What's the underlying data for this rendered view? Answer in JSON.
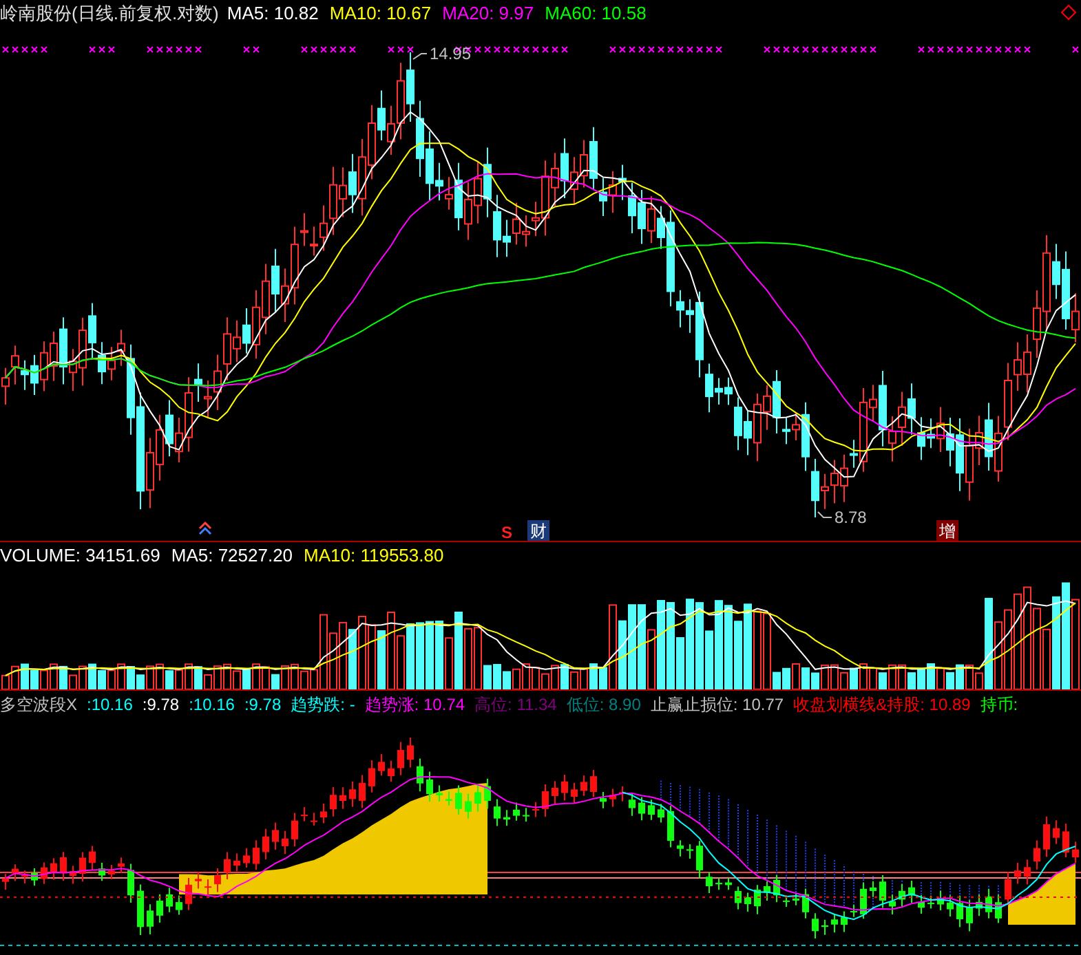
{
  "chart": {
    "title": "岭南股份(日线.前复权.对数)",
    "legend": [
      {
        "label": "MA5: 10.82",
        "color": "#ffffff"
      },
      {
        "label": "MA10: 10.67",
        "color": "#ffff00"
      },
      {
        "label": "MA20: 9.97",
        "color": "#ff00ff"
      },
      {
        "label": "MA60: 10.58",
        "color": "#00ff00"
      }
    ],
    "high_label": "14.95",
    "low_label": "8.78",
    "events": [
      {
        "kind": "sell",
        "text": "S"
      },
      {
        "kind": "finance",
        "text": "财"
      },
      {
        "kind": "increase",
        "text": "增"
      }
    ]
  },
  "volume": {
    "legend": [
      {
        "label": "VOLUME: 34151.69",
        "color": "#ffffff"
      },
      {
        "label": "MA5: 72527.20",
        "color": "#ffffff"
      },
      {
        "label": "MA10: 119553.80",
        "color": "#ffff00"
      }
    ]
  },
  "indicator": {
    "legend": [
      {
        "label": "多空波段X",
        "color": "#c0c0c0"
      },
      {
        "label": ":10.16",
        "color": "#00ffff"
      },
      {
        "label": ":9.78",
        "color": "#ffffff"
      },
      {
        "label": ":10.16",
        "color": "#00ffff"
      },
      {
        "label": ":9.78",
        "color": "#00ffff"
      },
      {
        "label": "趋势跌: -",
        "color": "#00ffff"
      },
      {
        "label": "趋势涨: 10.74",
        "color": "#ff00ff"
      },
      {
        "label": "高位: 11.34",
        "color": "#800080"
      },
      {
        "label": "低位: 8.90",
        "color": "#008080"
      },
      {
        "label": "止赢止损位: 10.77",
        "color": "#c0c0c0"
      },
      {
        "label": "收盘划横线&持股: 10.89",
        "color": "#ff0000"
      },
      {
        "label": "持币:",
        "color": "#00ff00"
      }
    ]
  }
}
